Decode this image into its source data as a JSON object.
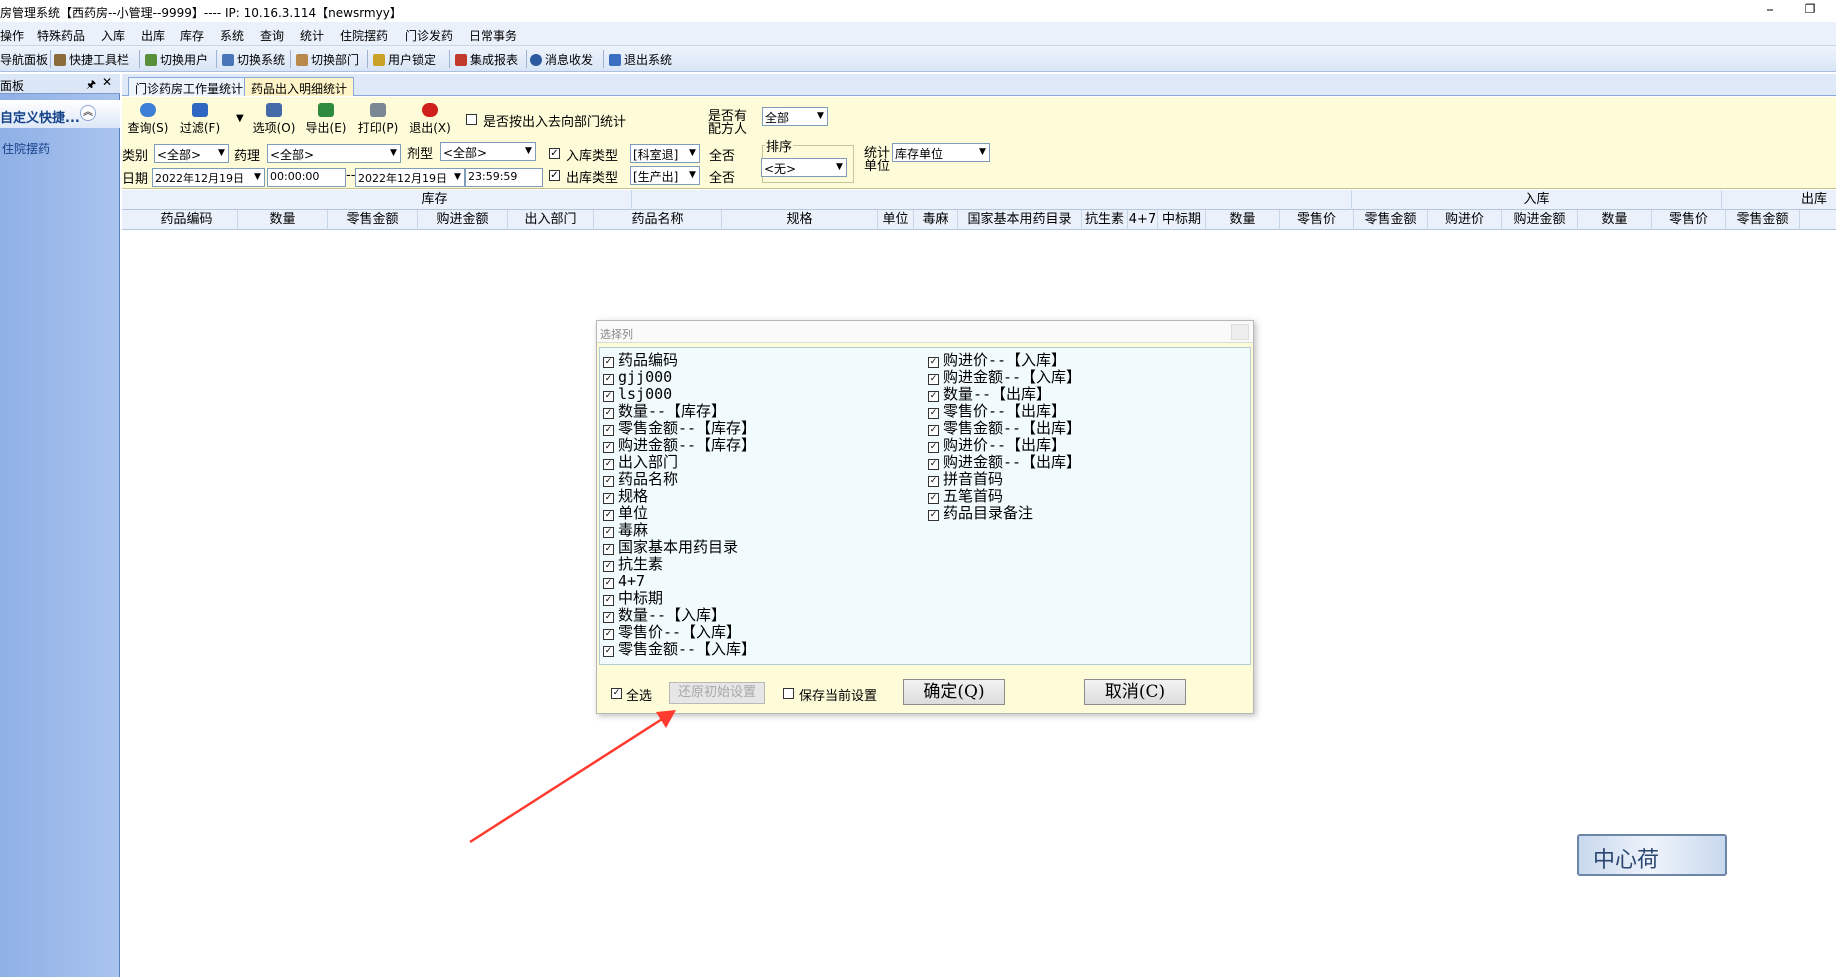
{
  "window": {
    "title": "房管理系统【西药房--小管理--9999】---- IP:  10.16.3.114【newsrmyy】",
    "minimize_glyph": "⎯",
    "restore_glyph": "❐"
  },
  "menu": [
    "操作",
    "特殊药品",
    "入库",
    "出库",
    "库存",
    "系统",
    "查询",
    "统计",
    "住院摆药",
    "门诊发药",
    "日常事务"
  ],
  "toolbar": {
    "items": [
      {
        "label": "导航面板",
        "icon": "navigation-panel-icon"
      },
      {
        "label": "快捷工具栏",
        "icon": "quick-toolbar-icon"
      },
      {
        "label": "切换用户",
        "icon": "switch-user-icon"
      },
      {
        "label": "切换系统",
        "icon": "switch-system-icon"
      },
      {
        "label": "切换部门",
        "icon": "switch-department-icon"
      },
      {
        "label": "用户锁定",
        "icon": "user-lock-icon"
      },
      {
        "label": "集成报表",
        "icon": "report-icon"
      },
      {
        "label": "消息收发",
        "icon": "message-icon"
      },
      {
        "label": "退出系统",
        "icon": "exit-system-icon"
      }
    ]
  },
  "left_panel": {
    "header": "面板",
    "pin_glyph": "🖈",
    "close_glyph": "✕",
    "group_title": "自定义快捷...",
    "group_chevron": "︽",
    "link": "住院摆药"
  },
  "tabs": [
    {
      "label": "门诊药房工作量统计",
      "active": false
    },
    {
      "label": "药品出入明细统计",
      "active": true
    }
  ],
  "filters": {
    "buttons": [
      {
        "label": "查询(S)",
        "icon": "refresh-icon"
      },
      {
        "label": "过滤(F)",
        "icon": "filter-icon"
      },
      {
        "label": "选项(O)",
        "icon": "options-icon"
      },
      {
        "label": "导出(E)",
        "icon": "excel-export-icon"
      },
      {
        "label": "打印(P)",
        "icon": "printer-icon"
      },
      {
        "label": "退出(X)",
        "icon": "power-icon"
      }
    ],
    "dropdown_glyph": "▼",
    "by_dept_label": "是否按出入去向部门统计",
    "prescriber_label_1": "是否有",
    "prescriber_label_2": "配方人",
    "prescriber_value": "全部",
    "category_label": "类别",
    "category_value": "<全部>",
    "pharmacology_label": "药理",
    "pharmacology_value": "<全部>",
    "dosage_label": "剂型",
    "dosage_value": "<全部>",
    "in_type_label": "入库类型",
    "in_type_value": "[科室退]",
    "in_select_all": "全否",
    "out_type_label": "出库类型",
    "out_type_value": "[生产出]",
    "out_select_all": "全否",
    "sort_label": "排序",
    "sort_value": "<无>",
    "unit_label_1": "统计",
    "unit_label_2": "单位",
    "unit_value": "库存单位",
    "date_label": "日期",
    "date_from": "2022年12月19日",
    "time_from": "00:00:00",
    "date_sep": "--",
    "date_to": "2022年12月19日",
    "time_to": "23:59:59",
    "combo_arrow": "▼",
    "checkmark": "✓"
  },
  "grid": {
    "group_headers": [
      "库存",
      "入库",
      "出库"
    ],
    "columns": [
      "药品编码",
      "数量",
      "零售金额",
      "购进金额",
      "出入部门",
      "药品名称",
      "规格",
      "单位",
      "毒麻",
      "国家基本用药目录",
      "抗生素",
      "4+7",
      "中标期",
      "数量",
      "零售价",
      "零售金额",
      "购进价",
      "购进金额",
      "数量",
      "零售价",
      "零售金额"
    ]
  },
  "dialog": {
    "title": "选择列",
    "left_items": [
      "药品编码",
      "gjj000",
      "lsj000",
      "数量--【库存】",
      "零售金额--【库存】",
      "购进金额--【库存】",
      "出入部门",
      "药品名称",
      "规格",
      "单位",
      "毒麻",
      "国家基本用药目录",
      "抗生素",
      "4+7",
      "中标期",
      "数量--【入库】",
      "零售价--【入库】",
      "零售金额--【入库】"
    ],
    "right_items": [
      "购进价--【入库】",
      "购进金额--【入库】",
      "数量--【出库】",
      "零售价--【出库】",
      "零售金额--【出库】",
      "购进价--【出库】",
      "购进金额--【出库】",
      "拼音首码",
      "五笔首码",
      "药品目录备注"
    ],
    "select_all_label": "全选",
    "restore_label": "还原初始设置",
    "save_label": "保存当前设置",
    "ok_label": "确定(Q)",
    "cancel_label": "取消(C)",
    "checkmark": "✓"
  },
  "stamp_text": "中心荷",
  "colors": {
    "accent_red": "#ff3b30",
    "panel_blue": "#8fb0e6",
    "filter_bg": "#fefbd8"
  }
}
